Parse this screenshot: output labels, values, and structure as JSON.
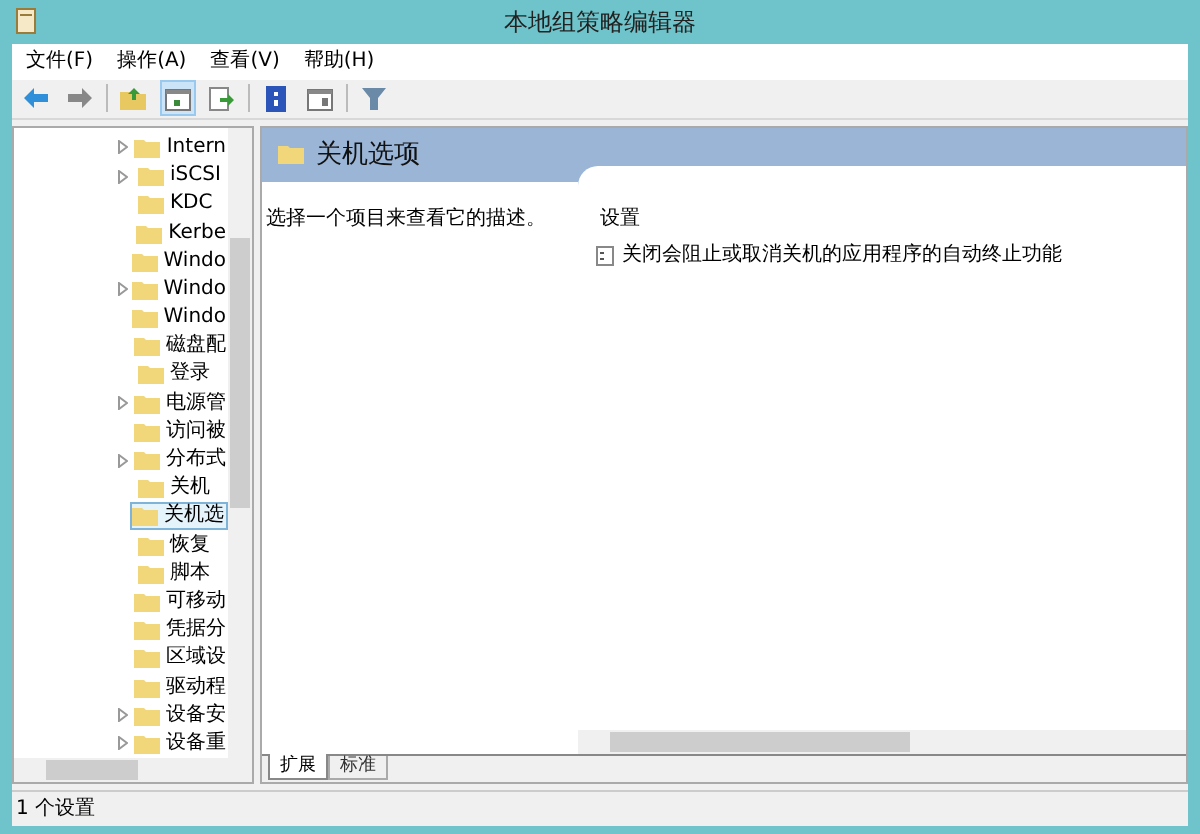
{
  "window": {
    "title": "本地组策略编辑器"
  },
  "menu": [
    "文件(F)",
    "操作(A)",
    "查看(V)",
    "帮助(H)"
  ],
  "toolbar": [
    {
      "kind": "back"
    },
    {
      "kind": "forward"
    },
    {
      "kind": "sep"
    },
    {
      "kind": "up"
    },
    {
      "kind": "tree",
      "selected": true
    },
    {
      "kind": "export"
    },
    {
      "kind": "sep"
    },
    {
      "kind": "help"
    },
    {
      "kind": "pane"
    },
    {
      "kind": "sep"
    },
    {
      "kind": "filter"
    }
  ],
  "tree": [
    {
      "label": "Intern",
      "has_children": true,
      "selected": false
    },
    {
      "label": "iSCSI",
      "has_children": true,
      "selected": false
    },
    {
      "label": "KDC",
      "has_children": false,
      "selected": false
    },
    {
      "label": "Kerbe",
      "has_children": false,
      "selected": false
    },
    {
      "label": "Windo",
      "has_children": false,
      "selected": false
    },
    {
      "label": "Windo",
      "has_children": true,
      "selected": false
    },
    {
      "label": "Windo",
      "has_children": false,
      "selected": false
    },
    {
      "label": "磁盘配",
      "has_children": false,
      "selected": false
    },
    {
      "label": "登录",
      "has_children": false,
      "selected": false
    },
    {
      "label": "电源管",
      "has_children": true,
      "selected": false
    },
    {
      "label": "访问被",
      "has_children": false,
      "selected": false
    },
    {
      "label": "分布式",
      "has_children": true,
      "selected": false
    },
    {
      "label": "关机",
      "has_children": false,
      "selected": false
    },
    {
      "label": "关机选",
      "has_children": false,
      "selected": true
    },
    {
      "label": "恢复",
      "has_children": false,
      "selected": false
    },
    {
      "label": "脚本",
      "has_children": false,
      "selected": false
    },
    {
      "label": "可移动",
      "has_children": false,
      "selected": false
    },
    {
      "label": "凭据分",
      "has_children": false,
      "selected": false
    },
    {
      "label": "区域设",
      "has_children": false,
      "selected": false
    },
    {
      "label": "驱动程",
      "has_children": false,
      "selected": false
    },
    {
      "label": "设备安",
      "has_children": true,
      "selected": false
    },
    {
      "label": "设备重",
      "has_children": true,
      "selected": false
    }
  ],
  "details": {
    "title": "关机选项",
    "description": "选择一个项目来查看它的描述。",
    "column": "设置",
    "settings": [
      "关闭会阻止或取消关机的应用程序的自动终止功能"
    ]
  },
  "tabs": [
    {
      "label": "扩展",
      "selected": true
    },
    {
      "label": "标准",
      "selected": false
    }
  ],
  "status_bar": "1 个设置"
}
